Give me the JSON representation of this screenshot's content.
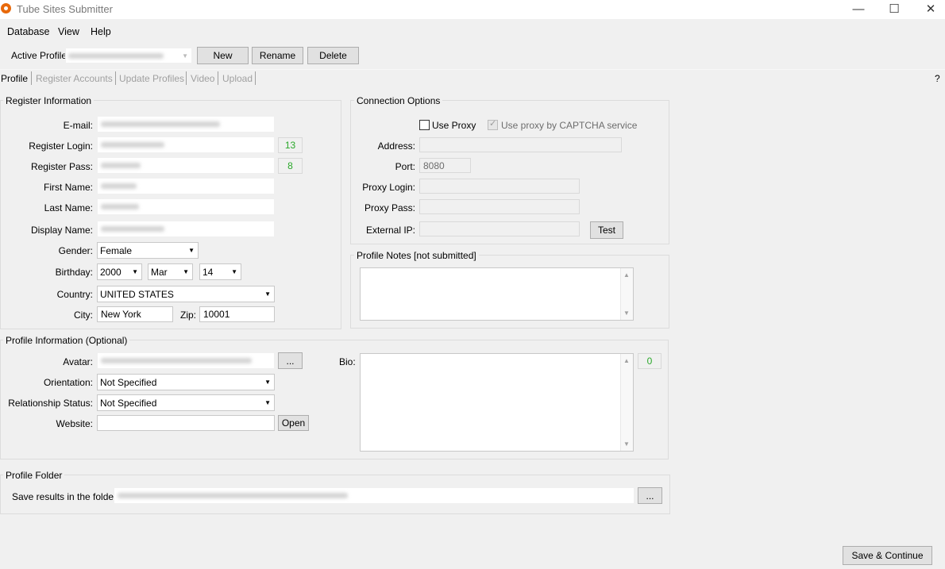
{
  "window": {
    "title": "Tube Sites Submitter",
    "controls": {
      "minimize": "—",
      "maximize": "☐",
      "close": "✕"
    }
  },
  "menu": [
    "Database",
    "View",
    "Help"
  ],
  "profile_bar": {
    "label": "Active Profile:",
    "new_label": "New",
    "rename_label": "Rename",
    "delete_label": "Delete"
  },
  "tabs": [
    "Profile",
    "Register Accounts",
    "Update Profiles",
    "Video",
    "Upload"
  ],
  "help_label": "?",
  "register": {
    "title": "Register Information",
    "email_label": "E-mail:",
    "login_label": "Register Login:",
    "login_count": "13",
    "pass_label": "Register Pass:",
    "pass_count": "8",
    "first_name_label": "First Name:",
    "last_name_label": "Last Name:",
    "display_name_label": "Display Name:",
    "gender_label": "Gender:",
    "gender_value": "Female",
    "birthday_label": "Birthday:",
    "birth_year": "2000",
    "birth_month": "Mar",
    "birth_day": "14",
    "country_label": "Country:",
    "country_value": "UNITED STATES",
    "city_label": "City:",
    "city_value": "New York",
    "zip_label": "Zip:",
    "zip_value": "10001"
  },
  "connection": {
    "title": "Connection Options",
    "use_proxy_label": "Use Proxy",
    "captcha_proxy_label": "Use proxy by CAPTCHA service",
    "address_label": "Address:",
    "port_label": "Port:",
    "port_value": "8080",
    "proxy_login_label": "Proxy Login:",
    "proxy_pass_label": "Proxy Pass:",
    "external_ip_label": "External IP:",
    "test_label": "Test"
  },
  "notes": {
    "title": "Profile Notes [not submitted]"
  },
  "profile_info": {
    "title": "Profile Information (Optional)",
    "avatar_label": "Avatar:",
    "browse_label": "...",
    "orientation_label": "Orientation:",
    "orientation_value": "Not Specified",
    "relationship_label": "Relationship Status:",
    "relationship_value": "Not Specified",
    "website_label": "Website:",
    "open_label": "Open",
    "bio_label": "Bio:",
    "bio_count": "0"
  },
  "folder": {
    "title": "Profile Folder",
    "save_label": "Save results in the folder:",
    "browse_label": "..."
  },
  "footer": {
    "save_continue_label": "Save & Continue"
  }
}
